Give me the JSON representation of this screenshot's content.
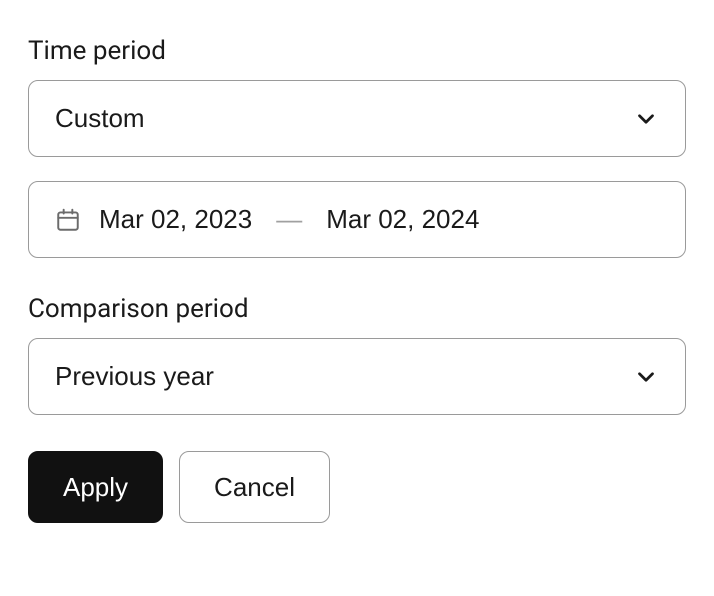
{
  "time_period": {
    "label": "Time period",
    "select_value": "Custom",
    "date_start": "Mar 02, 2023",
    "date_separator": "—",
    "date_end": "Mar 02, 2024"
  },
  "comparison_period": {
    "label": "Comparison period",
    "select_value": "Previous year"
  },
  "buttons": {
    "apply": "Apply",
    "cancel": "Cancel"
  }
}
